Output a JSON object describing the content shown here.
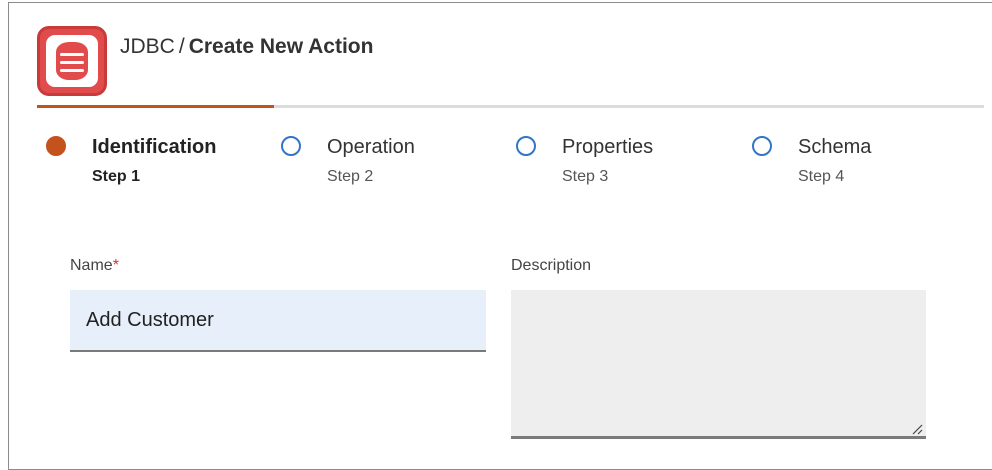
{
  "header": {
    "crumb": "JDBC",
    "separator": "/",
    "page_title": "Create New Action",
    "logo_icon": "database-icon",
    "accent_color": "#c3521d",
    "logo_color": "#e24b4b"
  },
  "progress": {
    "current_step": 1,
    "total_steps": 4
  },
  "steps": [
    {
      "label": "Identification",
      "sub": "Step 1",
      "active": true
    },
    {
      "label": "Operation",
      "sub": "Step 2",
      "active": false
    },
    {
      "label": "Properties",
      "sub": "Step 3",
      "active": false
    },
    {
      "label": "Schema",
      "sub": "Step 4",
      "active": false
    }
  ],
  "form": {
    "name_label": "Name",
    "required_mark": "*",
    "name_value": "Add Customer",
    "description_label": "Description",
    "description_value": ""
  }
}
